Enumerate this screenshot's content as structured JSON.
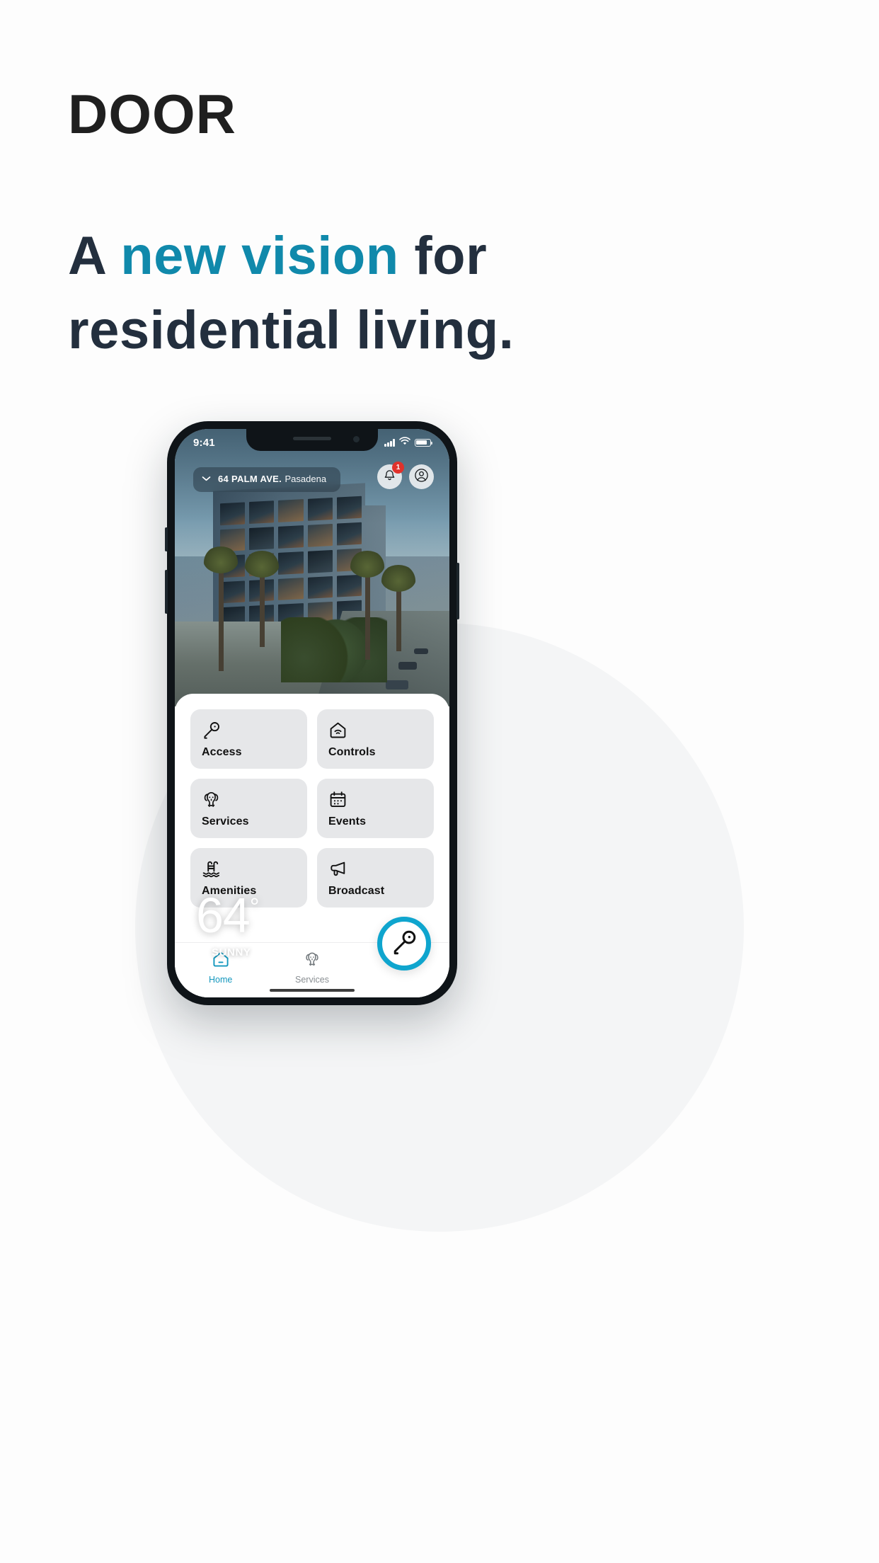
{
  "marketing": {
    "brand": "DOOR",
    "headline_part1": "A ",
    "headline_accent": "new vision",
    "headline_part2": " for",
    "headline_line2": "residential living.",
    "accent_color": "#1089ab",
    "text_color": "#232f3e"
  },
  "phone": {
    "statusbar": {
      "time": "9:41",
      "signal_icon": "signal-bars-icon",
      "wifi_icon": "wifi-icon",
      "battery_icon": "battery-icon"
    },
    "header": {
      "address_chevron_icon": "chevron-down-icon",
      "address_line1": "64 PALM AVE.",
      "address_line2": "Pasadena",
      "notifications_icon": "bell-icon",
      "notifications_badge": "1",
      "profile_icon": "user-circle-icon"
    },
    "weather": {
      "temperature": "64",
      "degree_symbol": "°",
      "condition": "SUNNY",
      "condition_icon": "sun-icon"
    },
    "tiles": [
      {
        "label": "Access",
        "icon": "key-icon"
      },
      {
        "label": "Controls",
        "icon": "home-wifi-icon"
      },
      {
        "label": "Services",
        "icon": "dog-icon"
      },
      {
        "label": "Events",
        "icon": "calendar-icon"
      },
      {
        "label": "Amenities",
        "icon": "pool-ladder-icon"
      },
      {
        "label": "Broadcast",
        "icon": "megaphone-icon"
      }
    ],
    "tabbar": {
      "tabs": [
        {
          "label": "Home",
          "icon": "home-icon",
          "active": true
        },
        {
          "label": "Services",
          "icon": "dog-icon",
          "active": false
        }
      ],
      "fab_icon": "key-icon",
      "active_color": "#1397bd",
      "inactive_color": "#8a8f93",
      "fab_ring_color": "#0fa5ce"
    }
  }
}
